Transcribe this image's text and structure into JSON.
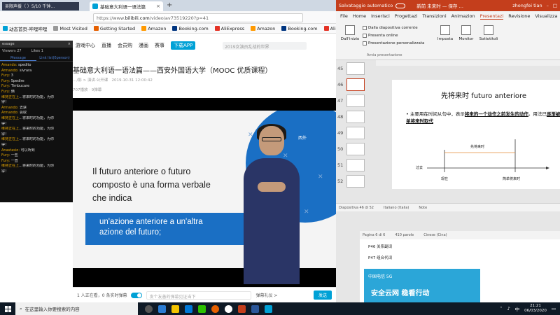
{
  "browser": {
    "stream_title": "吴限声援（  ）5/10 千钟…",
    "tab_title": "基础意大利语一语法篇",
    "tab_close": "×",
    "new_tab": "+",
    "url_host": "https://www.",
    "url_domain": "bilibili.com",
    "url_path": "/video/av73519220?p=41",
    "bookmarks": [
      {
        "label": "动态首页-哔哩哔哩",
        "color": "#00a1d6"
      },
      {
        "label": "Most Visited",
        "color": "#999999"
      },
      {
        "label": "Getting Started",
        "color": "#e66000"
      },
      {
        "label": "Amazon",
        "color": "#ff9900"
      },
      {
        "label": "Booking.com",
        "color": "#003580"
      },
      {
        "label": "AliExpress",
        "color": "#e43225"
      },
      {
        "label": "Amazon",
        "color": "#ff9900"
      },
      {
        "label": "Booking.com",
        "color": "#003580"
      },
      {
        "label": "AliExpress",
        "color": "#e43225"
      },
      {
        "label": "在线",
        "color": "#2b7cd3"
      }
    ]
  },
  "chat": {
    "header": "essage",
    "close": "×",
    "viewers": "Viewers 27",
    "likes": "Likes 1",
    "tab_message": "Message",
    "tab_link": "Link list(0person)",
    "messages": [
      {
        "user": "Amando:",
        "text": " spedito"
      },
      {
        "user": "Armando:",
        "text": " sivrara"
      },
      {
        "user": "Fury:",
        "text": " 3"
      },
      {
        "user": "Fury:",
        "text": " Spedire"
      },
      {
        "user": "Fury:",
        "text": " Timbucare"
      },
      {
        "user": "Fury:",
        "text": " 俩"
      },
      {
        "user": "维持正在上",
        "text": "…将来时的功能，为你"
      },
      {
        "user": "",
        "text": "得！"
      },
      {
        "user": "Armando:",
        "text": " 去获"
      },
      {
        "user": "Armando:",
        "text": " 会取"
      },
      {
        "user": "维持正在上",
        "text": "…将来时的功能，为你"
      },
      {
        "user": "",
        "text": "得！"
      },
      {
        "user": "维持正在上",
        "text": "…将来时的功能，为你"
      },
      {
        "user": "",
        "text": "得！"
      },
      {
        "user": "维持正在上",
        "text": "…将来时的功能，为你"
      },
      {
        "user": "",
        "text": "得！"
      },
      {
        "user": "Anastasio:",
        "text": " 可以听到"
      },
      {
        "user": "Fury:",
        "text": " 一些"
      },
      {
        "user": "Fury:",
        "text": " 一直"
      },
      {
        "user": "维持正在上",
        "text": "…将来时的功能，为你"
      },
      {
        "user": "",
        "text": "得！"
      }
    ]
  },
  "site": {
    "nav": [
      "游戏中心",
      "直播",
      "会员购",
      "漫画",
      "赛事"
    ],
    "upload": "下载APP",
    "search_placeholder": "2019女演员乱战的世界"
  },
  "video": {
    "title": "基础意大利语一语法篇——西安外国语大学（MOOC 优质课程）",
    "meta": "2019-10-31 12:00:42",
    "meta_prefix": "…/影 > 演讲·公开课",
    "meta2": "707播放 · 9弹幕",
    "slide_lines": [
      "Il futuro anteriore o futuro",
      "composto è una forma verbale",
      "che indica"
    ],
    "banner_lines": [
      "un'azione anteriore a un'altra",
      "azione del futuro;"
    ],
    "slide_logo": "西外"
  },
  "player_bar": {
    "watching": "1 人正在看，0 条实时弹幕",
    "input_placeholder": "发个友善的弹幕见证当下",
    "etiquette": "弹幕礼仪 >",
    "send": "发送"
  },
  "ppt": {
    "autosave": "Salvataggio automatico",
    "doc": "新前 未来时  —  保存 …",
    "user": "zhongfei tian",
    "menu": [
      "File",
      "Home",
      "Inserisci",
      "Progettazi",
      "Transizioni",
      "Animazion",
      "Presentazi",
      "Revisione",
      "Visualizza",
      "Guida"
    ],
    "active_menu": "Presentazi",
    "ribbon": {
      "from_start": "Dall'inizio",
      "items": [
        "Dalla diapositiva corrente",
        "Presenta online",
        "Presentazione personalizzata"
      ],
      "group": "Avvia presentazione",
      "setup": "Imposta",
      "monitor": "Monitor",
      "subtitles": "Sottotitoli"
    },
    "thumbs": [
      "45",
      "46",
      "47",
      "48",
      "49",
      "50",
      "51",
      "52"
    ],
    "slide_title": "先将来时 futuro anteriore",
    "slide_bullet_pre": "• 主要用在时间从句中，表示",
    "slide_bullet_bold": "将来的一个动作之前发生的动作",
    "slide_bullet_mid": "。用法已",
    "slide_bullet_bold2": "逐渐被简单将来时取代",
    "timeline": {
      "future": "先将来时",
      "past": "过去",
      "now": "现在",
      "simple": "简单将来时"
    },
    "status_slide": "Diapositiva 46 di 52",
    "status_lang": "Italiano (Italia)",
    "status_notes": "Note",
    "word_page": "Pagina 6 di 6",
    "word_count": "410 parole",
    "word_lang": "Cinese (Cina)",
    "doc_items": [
      "P46  关系副词",
      "P47  组合代词"
    ],
    "ad_top": "中国电信 5G",
    "ad_main": "安全云网  稳看行动"
  },
  "taskbar": {
    "search": "在这里输入你要搜索的内容",
    "time": "21:21",
    "date": "06/03/2020",
    "lang": "中"
  }
}
